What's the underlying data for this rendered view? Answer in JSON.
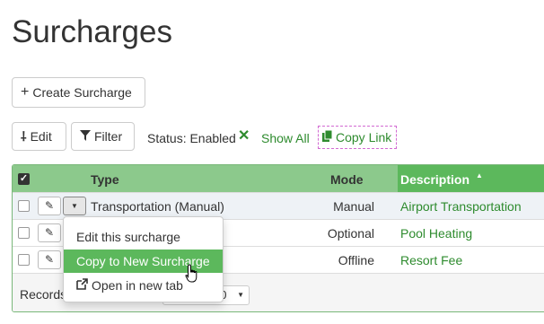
{
  "page": {
    "title": "Surcharges"
  },
  "toolbar": {
    "create_label": "Create Surcharge",
    "edit_label": "Edit",
    "filter_label": "Filter",
    "status_text": "Status: Enabled",
    "show_all_label": "Show All",
    "copy_link_label": "Copy Link"
  },
  "table": {
    "columns": {
      "type": "Type",
      "mode": "Mode",
      "description": "Description"
    },
    "rows": [
      {
        "type": "Transportation (Manual)",
        "mode": "Manual",
        "description": "Airport Transportation"
      },
      {
        "type": "",
        "mode": "Optional",
        "description": "Pool Heating"
      },
      {
        "type": "",
        "mode": "Offline",
        "description": "Resort Fee"
      }
    ],
    "footer": {
      "records_label": "Records",
      "records_value": "00"
    }
  },
  "dropdown": {
    "items": [
      {
        "label": "Edit this surcharge"
      },
      {
        "label": "Copy to New Surcharge"
      },
      {
        "label": "Open in new tab"
      }
    ]
  },
  "colors": {
    "accent": "#5cb85c",
    "header": "#8cc98c",
    "link": "#2e8b2e"
  },
  "icons": {
    "create": "plus-icon",
    "edit": "edit-icon",
    "filter": "filter-icon",
    "status_clear": "x-icon",
    "copy": "copy-icon",
    "sort": "sort-asc-icon",
    "row_edit": "pencil-icon",
    "row_menu": "caret-down-icon",
    "external": "external-link-icon"
  }
}
